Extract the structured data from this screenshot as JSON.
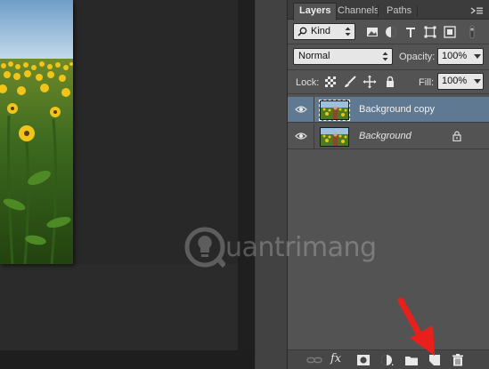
{
  "tabs": [
    {
      "label": "Layers",
      "active": true
    },
    {
      "label": "Channels",
      "active": false
    },
    {
      "label": "Paths",
      "active": false
    }
  ],
  "filter": {
    "kind_label": "Kind",
    "search_icon": "search-icon",
    "filter_icons": [
      "pixel-layer-filter-icon",
      "adjustment-layer-filter-icon",
      "type-layer-filter-icon",
      "shape-layer-filter-icon",
      "smart-object-filter-icon"
    ]
  },
  "blend": {
    "mode": "Normal",
    "opacity_label": "Opacity:",
    "opacity_value": "100%"
  },
  "lock": {
    "label": "Lock:",
    "fill_label": "Fill:",
    "fill_value": "100%",
    "icons": [
      "lock-transparent-pixels-icon",
      "lock-image-pixels-icon",
      "lock-position-icon",
      "lock-all-icon"
    ]
  },
  "layers": [
    {
      "name": "Background copy",
      "selected": true,
      "visible": true,
      "locked": false,
      "italic": false
    },
    {
      "name": "Background",
      "selected": false,
      "visible": true,
      "locked": true,
      "italic": true
    }
  ],
  "bottom_bar": {
    "icons": [
      "link-layers-icon",
      "fx-icon",
      "add-mask-icon",
      "adjustment-layer-icon",
      "new-group-icon",
      "new-layer-icon",
      "delete-layer-icon"
    ],
    "fx_label": "fx"
  },
  "watermark": {
    "text": "uantrimang"
  },
  "colors": {
    "panel_bg": "#535353",
    "selected_row": "#5f7993",
    "annotation_arrow": "#e8201b"
  }
}
